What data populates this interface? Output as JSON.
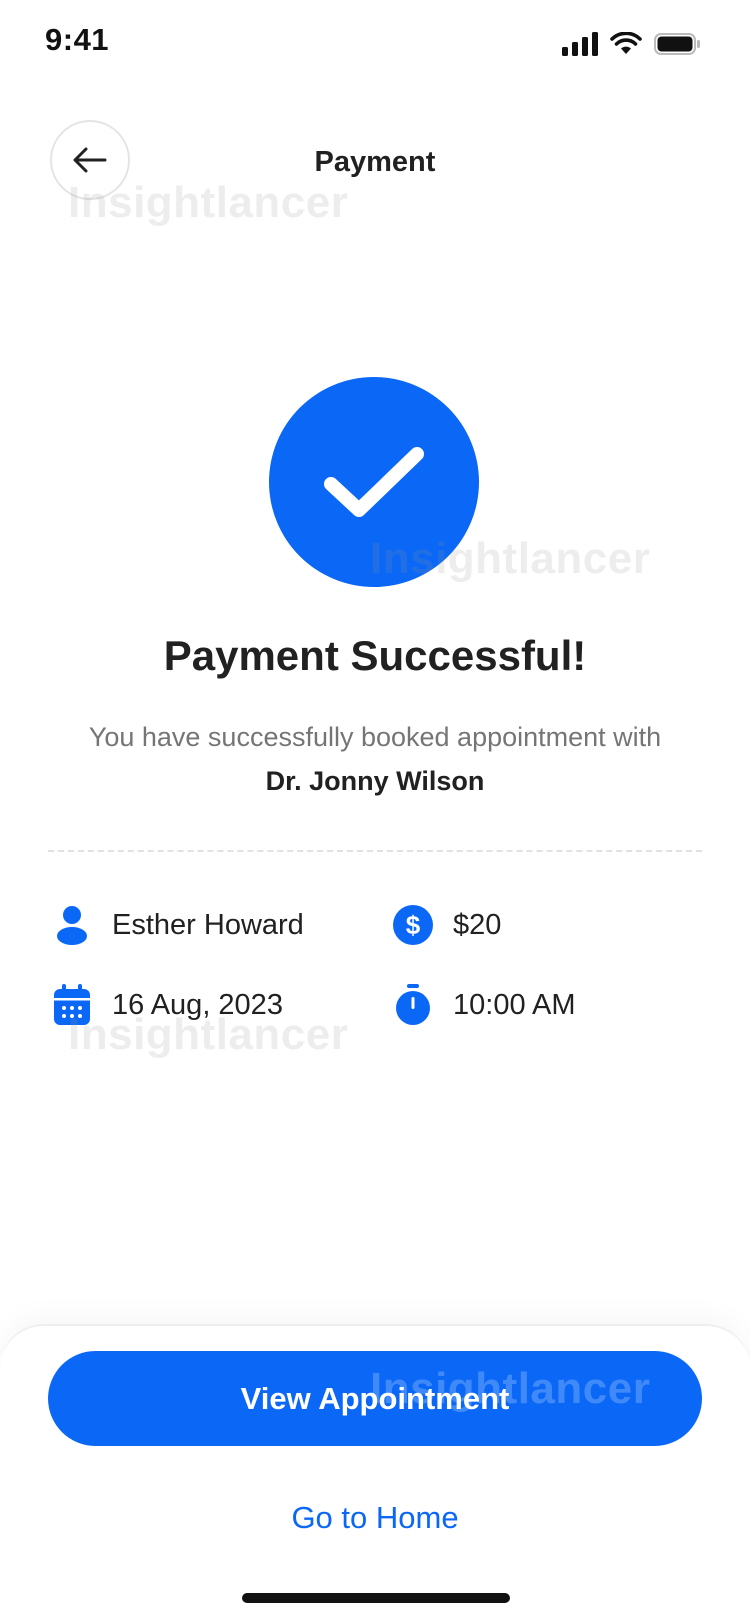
{
  "status_bar": {
    "time": "9:41"
  },
  "header": {
    "title": "Payment"
  },
  "watermark": "Insightlancer",
  "success": {
    "title": "Payment Successful!",
    "subtitle": "You have successfully booked appointment with",
    "doctor": "Dr. Jonny Wilson"
  },
  "details": {
    "patient": "Esther Howard",
    "amount": "$20",
    "date": "16 Aug, 2023",
    "time": "10:00 AM"
  },
  "actions": {
    "primary": "View Appointment",
    "secondary": "Go to Home"
  },
  "colors": {
    "accent": "#0b68f6",
    "text": "#212121",
    "muted": "#757575"
  },
  "icons": [
    "back-arrow-icon",
    "check-icon",
    "user-icon",
    "dollar-icon",
    "calendar-icon",
    "stopwatch-icon",
    "signal-icon",
    "wifi-icon",
    "battery-icon"
  ]
}
